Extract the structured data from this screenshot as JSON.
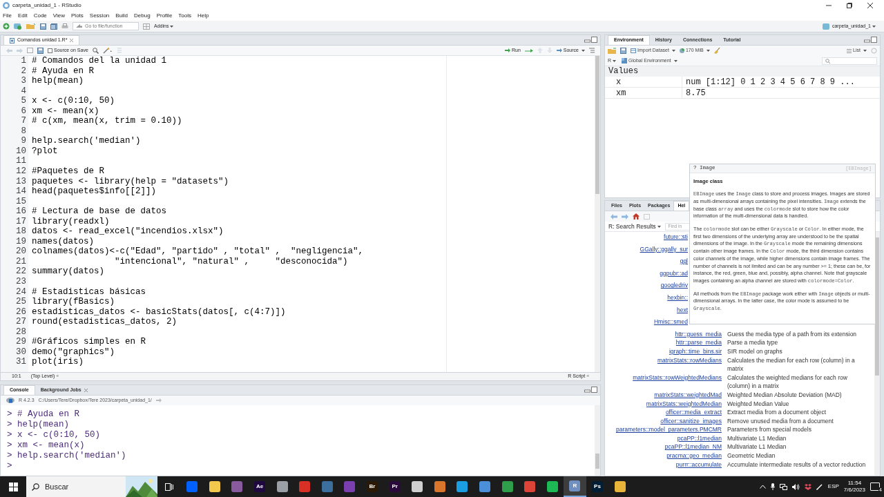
{
  "window": {
    "title": "carpeta_unidad_1 - RStudio",
    "project": "carpeta_unidad_1"
  },
  "menu": [
    "File",
    "Edit",
    "Code",
    "View",
    "Plots",
    "Session",
    "Build",
    "Debug",
    "Profile",
    "Tools",
    "Help"
  ],
  "toolbar": {
    "goto_placeholder": "Go to file/function",
    "addins": "Addins"
  },
  "editor": {
    "tabs": [
      {
        "label": "Comandos unidad 1.R*",
        "selected": true
      }
    ],
    "source_on_save": {
      "label": "Source on Save",
      "checked": false
    },
    "run": "Run",
    "source": "Source",
    "lines": [
      {
        "n": "1",
        "code": "# Comandos del la unidad 1"
      },
      {
        "n": "2",
        "code": "# Ayuda en R"
      },
      {
        "n": "3",
        "code": "help(mean)"
      },
      {
        "n": "4"
      },
      {
        "n": "5",
        "code": "x <- c(0:10, 50)"
      },
      {
        "n": "6",
        "code": "xm <- mean(x)"
      },
      {
        "n": "7",
        "code": "# c(xm, mean(x, trim = 0.10))"
      },
      {
        "n": "8"
      },
      {
        "n": "9",
        "code": "help.search('median')"
      },
      {
        "n": "10",
        "code": "?plot"
      },
      {
        "n": "11"
      },
      {
        "n": "12",
        "code": "#Paquetes de R"
      },
      {
        "n": "13",
        "code": "paquetes <- library(help = \"datasets\")"
      },
      {
        "n": "14",
        "code": "head(paquetes$info[[2]])"
      },
      {
        "n": "15"
      },
      {
        "n": "16",
        "code": "# Lectura de base de datos"
      },
      {
        "n": "17",
        "code": "library(readxl)"
      },
      {
        "n": "18",
        "code": "datos <- read_excel(\"incendios.xlsx\")"
      },
      {
        "n": "19",
        "code": "names(datos)"
      },
      {
        "n": "20",
        "code": "colnames(datos)<-c(\"Edad\", \"partido\" , \"total\" ,  \"negligencia\","
      },
      {
        "n": "21",
        "code": "                \"intencional\", \"natural\" ,     \"desconocida\")"
      },
      {
        "n": "22",
        "code": "summary(datos)"
      },
      {
        "n": "23"
      },
      {
        "n": "24",
        "code": "# Estadisticas básicas"
      },
      {
        "n": "25",
        "code": "library(fBasics)"
      },
      {
        "n": "26",
        "code": "estadisticas_datos <- basicStats(datos[, c(4:7)])"
      },
      {
        "n": "27",
        "code": "round(estadisticas_datos, 2)"
      },
      {
        "n": "28"
      },
      {
        "n": "29",
        "code": "#Gráficos simples en R"
      },
      {
        "n": "30",
        "code": "demo(\"graphics\")"
      },
      {
        "n": "31",
        "code": "plot(iris)"
      }
    ],
    "status": {
      "position": "10:1",
      "scope": "(Top Level) ÷",
      "type": "R Script ÷"
    }
  },
  "console": {
    "tabs": [
      {
        "label": "Console",
        "selected": true,
        "closable": false
      },
      {
        "label": "Background Jobs",
        "selected": false,
        "closable": true
      }
    ],
    "version": "R 4.2.3",
    "path": "C:/Users/Tere/Dropbox/Tere 2023/carpeta_unidad_1/",
    "lines": [
      "> # Ayuda en R",
      "> help(mean)",
      "> x <- c(0:10, 50)",
      "> xm <- mean(x)",
      "> help.search('median')",
      ">"
    ]
  },
  "environment": {
    "tabs": [
      {
        "label": "Environment",
        "selected": true
      },
      {
        "label": "History",
        "selected": false
      },
      {
        "label": "Connections",
        "selected": false
      },
      {
        "label": "Tutorial",
        "selected": false
      }
    ],
    "import": "Import Dataset",
    "memory": "170 MiB",
    "view": "List",
    "language": "R",
    "scope": "Global Environment",
    "section": "Values",
    "rows": [
      {
        "name": "x",
        "value": "num [1:12] 0 1 2 3 4 5 6 7 8 9 ..."
      },
      {
        "name": "xm",
        "value": "8.75"
      }
    ]
  },
  "help": {
    "tabs": [
      {
        "label": "Files",
        "selected": false
      },
      {
        "label": "Plots",
        "selected": false
      },
      {
        "label": "Packages",
        "selected": false
      },
      {
        "label": "Hel",
        "selected": true
      }
    ],
    "page": "R: Search Results",
    "find_placeholder": "Find in",
    "results": [
      {
        "kind": "covered",
        "name": "future::sti"
      },
      {
        "kind": "covered",
        "name": "GGally::ggally_sur"
      },
      {
        "kind": "covered",
        "name": "ggl"
      },
      {
        "kind": "covered",
        "name": "ggpubr::ad"
      },
      {
        "kind": "covered",
        "name": "googledriv"
      },
      {
        "kind": "covered",
        "name": "hexbin::"
      },
      {
        "kind": "covered",
        "name": "hext"
      },
      {
        "kind": "covered",
        "name": "Hmisc::smed"
      },
      {
        "kind": "result",
        "name": "httr::guess_media",
        "desc": "Guess the media type of a path from its extension"
      },
      {
        "kind": "result",
        "name": "httr::parse_media",
        "desc": "Parse a media type"
      },
      {
        "kind": "result",
        "name": "igraph::time_bins.sir",
        "desc": "SIR model on graphs"
      },
      {
        "kind": "result",
        "name": "matrixStats::rowMedians",
        "desc": "Calculates the median for each row (column) in a matrix"
      },
      {
        "kind": "result",
        "name": "matrixStats::rowWeightedMedians",
        "desc": "Calculates the weighted medians for each row (column) in a matrix"
      },
      {
        "kind": "result",
        "name": "matrixStats::weightedMad",
        "desc": "Weighted Median Absolute Deviation (MAD)"
      },
      {
        "kind": "result",
        "name": "matrixStats::weightedMedian",
        "desc": "Weighted Median Value"
      },
      {
        "kind": "result",
        "name": "officer::media_extract",
        "desc": "Extract media from a document object"
      },
      {
        "kind": "result",
        "name": "officer::sanitize_images",
        "desc": "Remove unused media from a document"
      },
      {
        "kind": "result",
        "name": "parameters::model_parameters.PMCMR",
        "desc": "Parameters from special models"
      },
      {
        "kind": "result",
        "name": "pcaPP::l1median",
        "desc": "Multivariate L1 Median"
      },
      {
        "kind": "result",
        "name": "pcaPP::l1median_NM",
        "desc": "Multivariate L1 Median"
      },
      {
        "kind": "result",
        "name": "pracma::geo_median",
        "desc": "Geometric Median"
      },
      {
        "kind": "result",
        "name": "purrr::accumulate",
        "desc": "Accumulate intermediate results of a vector reduction"
      }
    ]
  },
  "tooltip": {
    "title": "? Image",
    "package": "[EBImage]",
    "heading": "Image class",
    "paragraphs": [
      [
        {
          "text": "EBImage",
          "code": true
        },
        {
          "text": " uses the ",
          "code": false
        },
        {
          "text": "Image",
          "code": true
        },
        {
          "text": " class to store and process images. Images are stored as multi-dimensional arrays containing the pixel intensities. ",
          "code": false
        },
        {
          "text": "Image",
          "code": true
        },
        {
          "text": " extends the base class ",
          "code": false
        },
        {
          "text": "array",
          "code": true
        },
        {
          "text": " and uses the ",
          "code": false
        },
        {
          "text": "colormode",
          "code": true
        },
        {
          "text": " slot to store how the color information of the multi-dimensional data is handled.",
          "code": false
        }
      ],
      [
        {
          "text": "The ",
          "code": false
        },
        {
          "text": "colormode",
          "code": true
        },
        {
          "text": " slot can be either ",
          "code": false
        },
        {
          "text": "Grayscale",
          "code": true
        },
        {
          "text": " or ",
          "code": false
        },
        {
          "text": "Color",
          "code": true
        },
        {
          "text": ". In either mode, the first two dimensions of the underlying array are understood to be the spatial dimensions of the image. In the ",
          "code": false
        },
        {
          "text": "Grayscale",
          "code": true
        },
        {
          "text": " mode the remaining dimensions contain other image frames. In the ",
          "code": false
        },
        {
          "text": "Color",
          "code": true
        },
        {
          "text": " mode, the third dimension contains color channels of the image, while higher dimensions contain image frames. The number of channels is not limited and can be any number >= 1; these can be, for instance, the red, green, blue and, possibly, alpha channel. Note that grayscale images containing an alpha channel are stored with ",
          "code": false
        },
        {
          "text": "colormode=Color",
          "code": true
        },
        {
          "text": ".",
          "code": false
        }
      ],
      [
        {
          "text": "All methods from the ",
          "code": false
        },
        {
          "text": "EBImage",
          "code": true
        },
        {
          "text": " package work either with ",
          "code": false
        },
        {
          "text": "Image",
          "code": true
        },
        {
          "text": " objects or multi-dimensional arrays. In the latter case, the color mode is assumed to be ",
          "code": false
        },
        {
          "text": "Grayscale",
          "code": true
        },
        {
          "text": ".",
          "code": false
        }
      ]
    ]
  },
  "taskbar": {
    "search_placeholder": "Buscar",
    "apps": [
      {
        "color": "#0061fe",
        "active": false
      },
      {
        "color": "#f2c94c",
        "active": false
      },
      {
        "color": "#8a5a9e",
        "active": false
      },
      {
        "label": "Ae",
        "color": "#1f0740",
        "active": false
      },
      {
        "color": "#9aa0a6",
        "active": false
      },
      {
        "color": "#d93025",
        "active": false
      },
      {
        "color": "#3c6e9e",
        "active": false
      },
      {
        "color": "#7b3fb0",
        "active": false
      },
      {
        "label": "Br",
        "color": "#2a1a05",
        "active": false
      },
      {
        "label": "Pr",
        "color": "#2a0a3a",
        "active": false
      },
      {
        "color": "#cfcfcf",
        "active": false
      },
      {
        "color": "#d9762b",
        "active": false
      },
      {
        "color": "#1b9de2",
        "active": false
      },
      {
        "color": "#4a8fd8",
        "active": false
      },
      {
        "color": "#2e9e4a",
        "active": false
      },
      {
        "color": "#db4437",
        "active": false
      },
      {
        "color": "#1db954",
        "active": false
      },
      {
        "label": "R",
        "color": "#6e8fbf",
        "active": true
      },
      {
        "label": "Ps",
        "color": "#001e36",
        "active": false
      },
      {
        "color": "#e8b53a",
        "active": false
      }
    ],
    "language": "ESP",
    "time": "11:54",
    "date": "7/6/2023",
    "notifications": "4"
  }
}
